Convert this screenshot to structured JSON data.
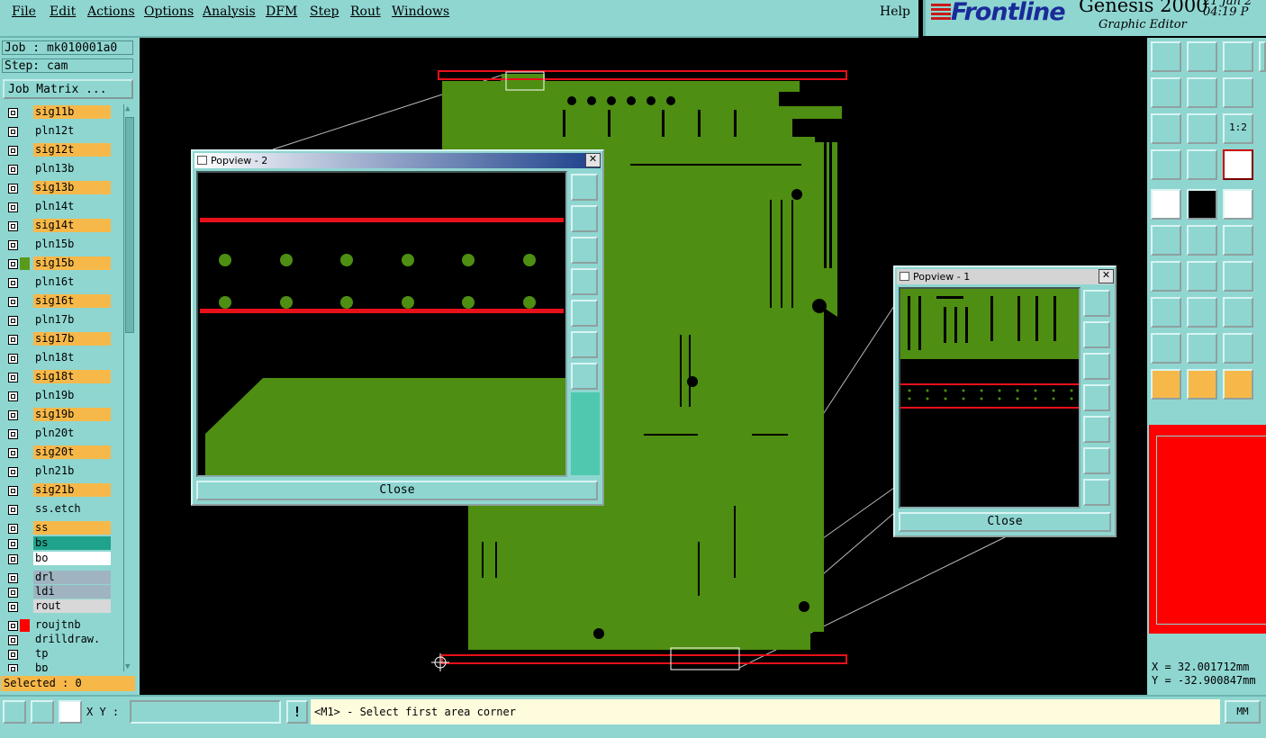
{
  "menu": {
    "items": [
      "File",
      "Edit",
      "Actions",
      "Options",
      "Analysis",
      "DFM",
      "Step",
      "Rout",
      "Windows"
    ],
    "help": "Help"
  },
  "brand": {
    "logo": "Frontline",
    "product": "Genesis 2000",
    "subtitle": "Graphic Editor",
    "date": "21 Jan 2",
    "time": "04:19 P"
  },
  "left": {
    "job": "Job : mk010001a0",
    "step": "Step: cam",
    "job_matrix": "Job Matrix ...",
    "selected": "Selected : 0",
    "layers": [
      {
        "name": "sig11b",
        "color": "#f7b84a",
        "swatch": ""
      },
      {
        "name": "pln12t",
        "color": "#8fd6d1",
        "swatch": ""
      },
      {
        "name": "sig12t",
        "color": "#f7b84a",
        "swatch": ""
      },
      {
        "name": "pln13b",
        "color": "#8fd6d1",
        "swatch": ""
      },
      {
        "name": "sig13b",
        "color": "#f7b84a",
        "swatch": ""
      },
      {
        "name": "pln14t",
        "color": "#8fd6d1",
        "swatch": ""
      },
      {
        "name": "sig14t",
        "color": "#f7b84a",
        "swatch": ""
      },
      {
        "name": "pln15b",
        "color": "#8fd6d1",
        "swatch": ""
      },
      {
        "name": "sig15b",
        "color": "#f7b84a",
        "swatch": "#5a9a1a"
      },
      {
        "name": "pln16t",
        "color": "#8fd6d1",
        "swatch": ""
      },
      {
        "name": "sig16t",
        "color": "#f7b84a",
        "swatch": ""
      },
      {
        "name": "pln17b",
        "color": "#8fd6d1",
        "swatch": ""
      },
      {
        "name": "sig17b",
        "color": "#f7b84a",
        "swatch": ""
      },
      {
        "name": "pln18t",
        "color": "#8fd6d1",
        "swatch": ""
      },
      {
        "name": "sig18t",
        "color": "#f7b84a",
        "swatch": ""
      },
      {
        "name": "pln19b",
        "color": "#8fd6d1",
        "swatch": ""
      },
      {
        "name": "sig19b",
        "color": "#f7b84a",
        "swatch": ""
      },
      {
        "name": "pln20t",
        "color": "#8fd6d1",
        "swatch": ""
      },
      {
        "name": "sig20t",
        "color": "#f7b84a",
        "swatch": ""
      },
      {
        "name": "pln21b",
        "color": "#8fd6d1",
        "swatch": ""
      },
      {
        "name": "sig21b",
        "color": "#f7b84a",
        "swatch": ""
      },
      {
        "name": "ss.etch",
        "color": "#8fd6d1",
        "swatch": ""
      },
      {
        "name": "ss",
        "color": "#f7b84a",
        "swatch": ""
      },
      {
        "name": "bs",
        "color": "#1fa38c",
        "swatch": ""
      },
      {
        "name": "bo",
        "color": "#ffffff",
        "swatch": ""
      },
      {
        "name": "drl",
        "color": "#9fb4c0",
        "swatch": ""
      },
      {
        "name": "ldi",
        "color": "#9fb4c0",
        "swatch": ""
      },
      {
        "name": "rout",
        "color": "#d8d8d8",
        "swatch": ""
      },
      {
        "name": "roujtnb",
        "color": "#8fd6d1",
        "swatch": "#ff0000"
      },
      {
        "name": "drilldraw.",
        "color": "#8fd6d1",
        "swatch": ""
      },
      {
        "name": "tp",
        "color": "#8fd6d1",
        "swatch": ""
      },
      {
        "name": "bp",
        "color": "#8fd6d1",
        "swatch": ""
      }
    ]
  },
  "right": {
    "coord_x": "X = 32.001712mm",
    "coord_y": "Y = -32.900847mm"
  },
  "bottom": {
    "xy_label": "X Y :",
    "xy_value": "",
    "warn": "!",
    "prompt": "<M1> - Select first area corner",
    "units": "MM"
  },
  "popview2": {
    "title": "Popview - 2",
    "close": "Close"
  },
  "popview1": {
    "title": "Popview - 1",
    "close": "Close"
  },
  "colors": {
    "ui": "#8fd6d1",
    "board": "#4e8e12",
    "trace": "#e8101a",
    "accent": "#f7b84a"
  }
}
